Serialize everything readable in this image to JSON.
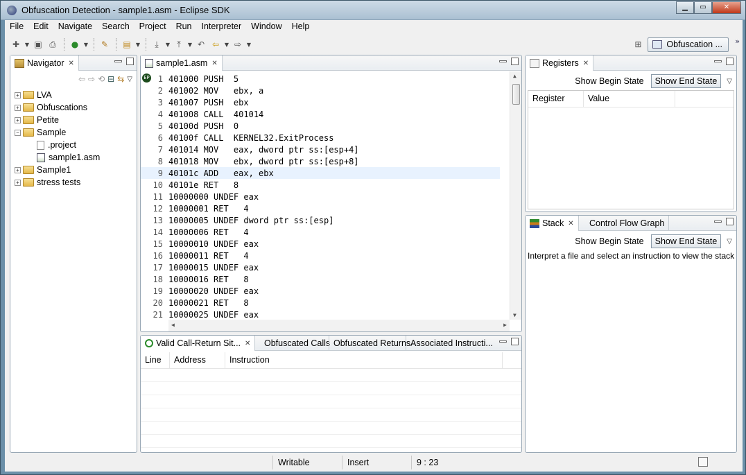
{
  "window": {
    "title": "Obfuscation Detection - sample1.asm - Eclipse SDK"
  },
  "menu": [
    "File",
    "Edit",
    "Navigate",
    "Search",
    "Project",
    "Run",
    "Interpreter",
    "Window",
    "Help"
  ],
  "perspective": {
    "label": "Obfuscation ..."
  },
  "navigator": {
    "title": "Navigator",
    "items": [
      {
        "label": "LVA",
        "type": "folder",
        "expanded": false
      },
      {
        "label": "Obfuscations",
        "type": "folder",
        "expanded": false
      },
      {
        "label": "Petite",
        "type": "folder",
        "expanded": false
      },
      {
        "label": "Sample",
        "type": "folder",
        "expanded": true
      },
      {
        "label": ".project",
        "type": "file"
      },
      {
        "label": "sample1.asm",
        "type": "asm"
      },
      {
        "label": "Sample1",
        "type": "folder",
        "expanded": false
      },
      {
        "label": "stress tests",
        "type": "folder",
        "expanded": false
      }
    ]
  },
  "editor": {
    "tab": "sample1.asm",
    "current_line": 9,
    "lines": [
      {
        "n": "1",
        "text": "401000 PUSH  5"
      },
      {
        "n": "2",
        "text": "401002 MOV   ebx, a"
      },
      {
        "n": "3",
        "text": "401007 PUSH  ebx"
      },
      {
        "n": "4",
        "text": "401008 CALL  401014"
      },
      {
        "n": "5",
        "text": "40100d PUSH  0"
      },
      {
        "n": "6",
        "text": "40100f CALL  KERNEL32.ExitProcess"
      },
      {
        "n": "7",
        "text": "401014 MOV   eax, dword ptr ss:[esp+4]"
      },
      {
        "n": "8",
        "text": "401018 MOV   ebx, dword ptr ss:[esp+8]"
      },
      {
        "n": "9",
        "text": "40101c ADD   eax, ebx"
      },
      {
        "n": "10",
        "text": "40101e RET   8"
      },
      {
        "n": "11",
        "text": "10000000 UNDEF eax"
      },
      {
        "n": "12",
        "text": "10000001 RET   4"
      },
      {
        "n": "13",
        "text": "10000005 UNDEF dword ptr ss:[esp]"
      },
      {
        "n": "14",
        "text": "10000006 RET   4"
      },
      {
        "n": "15",
        "text": "10000010 UNDEF eax"
      },
      {
        "n": "16",
        "text": "10000011 RET   4"
      },
      {
        "n": "17",
        "text": "10000015 UNDEF eax"
      },
      {
        "n": "18",
        "text": "10000016 RET   8"
      },
      {
        "n": "19",
        "text": "10000020 UNDEF eax"
      },
      {
        "n": "20",
        "text": "10000021 RET   8"
      },
      {
        "n": "21",
        "text": "10000025 UNDEF eax"
      }
    ]
  },
  "bottom_panel": {
    "tabs": [
      "Valid Call-Return Sit...",
      "Obfuscated Calls",
      "Obfuscated Returns",
      "Associated Instructi..."
    ],
    "columns": [
      "Line",
      "Address",
      "Instruction"
    ]
  },
  "registers": {
    "title": "Registers",
    "show_begin": "Show Begin State",
    "show_end": "Show End State",
    "columns": [
      "Register",
      "Value"
    ]
  },
  "stack": {
    "tabs": [
      "Stack",
      "Control Flow Graph"
    ],
    "show_begin": "Show Begin State",
    "show_end": "Show End State",
    "message": "Interpret a file and select an instruction to view the stack"
  },
  "status": {
    "writable": "Writable",
    "insert": "Insert",
    "position": "9 : 23"
  }
}
